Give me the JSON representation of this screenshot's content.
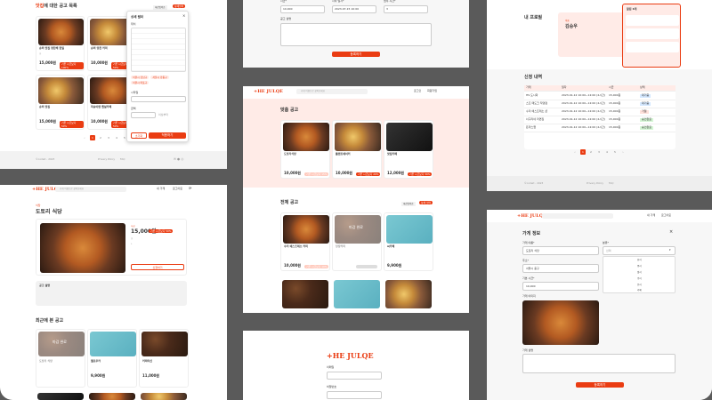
{
  "p1": {
    "title_prefix": "맛집",
    "title_rest": "에 대한 공고 목록",
    "sort": "마감임박순",
    "filter_btn": "상세필터",
    "cards": [
      {
        "name": "슈퍼 맛집 정찬해 한일",
        "price": "15,000원",
        "badge": "기존 시급보다 100%"
      },
      {
        "name": "슈퍼 당찬 커피",
        "price": "10,000원",
        "badge": "기존 시급보다 50%"
      },
      {
        "name": "슈퍼 맛집",
        "price": "15,000원",
        "badge": "기존 시급보다 50%"
      },
      {
        "name": "복숭아맨 랩실카페",
        "price": "10,000원",
        "badge": "기존 시급보다 50%"
      }
    ],
    "filter": {
      "title": "상세 필터",
      "loc_label": "위치",
      "chips": [
        "서울시 강남구",
        "서울시 강동구",
        "서울시 마포구"
      ],
      "start_label": "시작일",
      "amount_label": "금액",
      "amount_suffix": "이상부터",
      "reset": "초기화",
      "apply": "적용하기"
    },
    "pages": [
      "1",
      "2",
      "3",
      "4",
      "5"
    ],
    "footer": "©codeit - 2023",
    "footer_links": [
      "Privacy Policy",
      "FAQ"
    ]
  },
  "p2": {
    "fields": [
      "시급*",
      "시작 일시*",
      "업무 시간*"
    ],
    "values": [
      "10,000",
      "2023-07-15 10:00",
      "3"
    ],
    "desc_label": "공고 설명",
    "button": "등록하기"
  },
  "p3": {
    "search": "가게 이름으로 찾아보세요",
    "nav": [
      "로그인",
      "회원가입"
    ],
    "section1": "맞춤 공고",
    "section2": "전체 공고",
    "sort": "마감임박순",
    "filter_btn": "상세 필터",
    "cards1": [
      {
        "name": "도토리식당",
        "price": "10,000원",
        "badge": "기존 시급보다 15%"
      },
      {
        "name": "플랜트에이커",
        "price": "10,000원",
        "badge": "기존 시급보다 20%"
      },
      {
        "name": "맛집카페",
        "price": "12,000원",
        "badge": "기존 시급보다 30%"
      }
    ],
    "cards2": [
      {
        "name": "수리 에스프레소 커피",
        "price": "10,000원",
        "badge": "기존 시급보다 10%"
      },
      {
        "name": "당장커피",
        "price": "",
        "badge": "",
        "closed": "마감 완료"
      },
      {
        "name": "씨카페",
        "price": "9,900원",
        "badge": ""
      }
    ]
  },
  "p4": {
    "profile_title": "내 프로필",
    "name_label": "이름",
    "name": "김승우",
    "notify_title": "알림 6개",
    "history_title": "신청 내역",
    "cols": [
      "가게",
      "일자",
      "시급",
      "상태"
    ],
    "rows": [
      [
        "HS 도시락",
        "2023-01-12 10:00~12:00 (2시간)",
        "15,000원",
        "대기중"
      ],
      [
        "스프 매도크 직영점",
        "2023-01-12 10:00~12:00 (2시간)",
        "15,000원",
        "대기중"
      ],
      [
        "수리 에스프레소 샵",
        "2023-01-12 10:00~12:00 (2시간)",
        "15,000원",
        "거절"
      ],
      [
        "너구리네 라면집",
        "2023-01-12 10:00~12:00 (2시간)",
        "15,000원",
        "승인완료"
      ],
      [
        "돈까스랩",
        "2023-01-12 10:00~12:00 (2시간)",
        "15,000원",
        "승인완료"
      ]
    ],
    "footer": "©codeit - 2023",
    "footer_links": [
      "Privacy Policy",
      "FAQ"
    ]
  },
  "p5": {
    "logo": "+HE JULQE",
    "search": "가게 이름으로 찾아보세요",
    "nav": [
      "내 가게",
      "로그아웃"
    ],
    "cat": "식당",
    "store": "도토리 식당",
    "wage_label": "시급",
    "wage": "15,000원",
    "badge": "기존 시급보다 50%",
    "apply": "신청하기",
    "desc_label": "공고 설명",
    "recent": "최근에 본 공고",
    "cards": [
      {
        "name": "도토리 식당",
        "price": "",
        "closed": "마감 완료"
      },
      {
        "name": "엘로우카",
        "price": "9,900원"
      },
      {
        "name": "커피마신",
        "price": "11,000원"
      }
    ]
  },
  "p6": {
    "logo": "+HE JULQE",
    "id_label": "이메일",
    "pw_label": "비밀번호"
  },
  "p7": {
    "logo": "+HE JULQE",
    "nav": [
      "내 가게",
      "로그아웃"
    ],
    "title": "가게 정보",
    "labels": [
      "가게 이름*",
      "분류*",
      "주소*",
      "상세 주소*",
      "기본 시급*",
      "가게 이미지",
      "가게 설명"
    ],
    "values": [
      "도토리 식당",
      "",
      "서울시 중구",
      "",
      "10,000"
    ],
    "select_ph": "선택",
    "options": [
      "한식",
      "중식",
      "일식",
      "양식",
      "분식",
      "카페"
    ],
    "button": "등록하기"
  }
}
